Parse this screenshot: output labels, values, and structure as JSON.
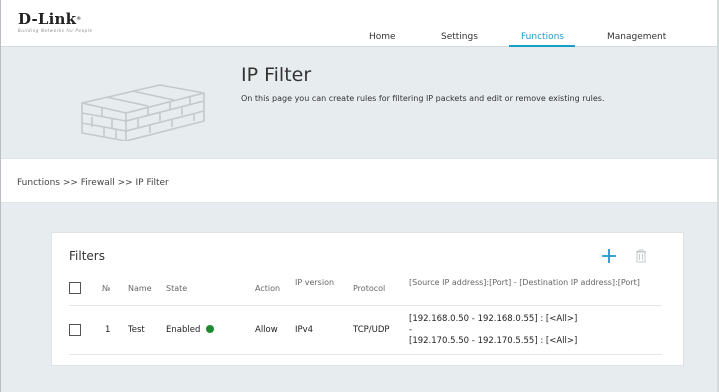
{
  "brand": {
    "name": "D-Link",
    "tagline": "Building Networks for People"
  },
  "nav": {
    "items": [
      {
        "label": "Home"
      },
      {
        "label": "Settings"
      },
      {
        "label": "Functions"
      },
      {
        "label": "Management"
      }
    ],
    "active_color": "#1a9cc9"
  },
  "header": {
    "title": "IP Filter",
    "description": "On this page you can create rules for filtering IP packets and edit or remove existing rules."
  },
  "breadcrumb": "Functions >> Firewall >> IP Filter",
  "filters": {
    "title": "Filters",
    "columns": {
      "number": "№",
      "name": "Name",
      "state": "State",
      "action": "Action",
      "ip_version": "IP version",
      "protocol": "Protocol",
      "addresses": "[Source IP address]:[Port] - [Destination IP address]:[Port]"
    },
    "rows": [
      {
        "number": "1",
        "name": "Test",
        "state": "Enabled",
        "state_color": "#1f8a2e",
        "action": "Allow",
        "ip_version": "IPv4",
        "protocol": "TCP/UDP",
        "address_source": "[192.168.0.50 - 192.168.0.55] : [<All>]",
        "address_sep": "-",
        "address_dest": "[192.170.5.50 - 192.170.5.55] : [<All>]"
      }
    ]
  }
}
